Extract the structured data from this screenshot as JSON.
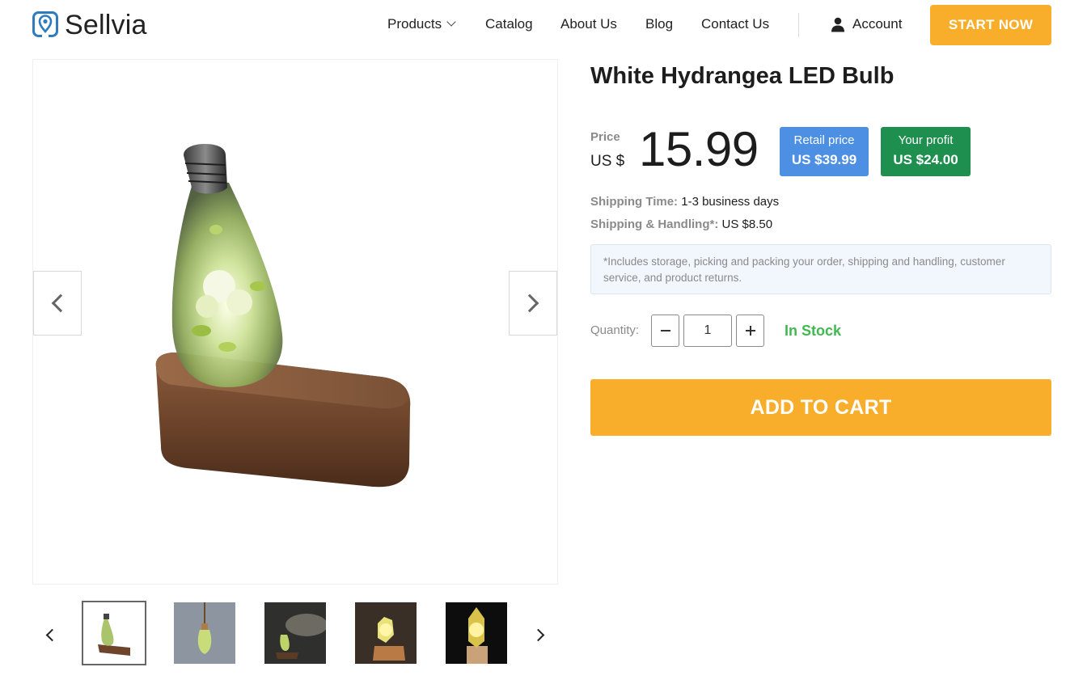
{
  "brand": {
    "name": "Sellvia",
    "logo_icon": "map-pin-logo-icon",
    "accent": "#2e7bc0"
  },
  "nav": {
    "items": [
      {
        "label": "Products",
        "has_dropdown": true
      },
      {
        "label": "Catalog"
      },
      {
        "label": "About Us"
      },
      {
        "label": "Blog"
      },
      {
        "label": "Contact Us"
      }
    ],
    "account_label": "Account",
    "account_icon": "user-icon",
    "cta_label": "START NOW"
  },
  "gallery": {
    "prev_icon": "chevron-left-icon",
    "next_icon": "chevron-right-icon",
    "thumbnail_count": 5,
    "active_thumbnail": 1
  },
  "product": {
    "title": "White Hydrangea LED Bulb",
    "price_label": "Price",
    "currency": "US $",
    "price": "15.99",
    "retail_label": "Retail price",
    "retail_value": "US $39.99",
    "profit_label": "Your profit",
    "profit_value": "US $24.00",
    "shipping_time_label": "Shipping Time:",
    "shipping_time_value": "1-3 business days",
    "shipping_handling_label": "Shipping & Handling*:",
    "shipping_handling_value": "US $8.50",
    "note": "*Includes storage, picking and packing your order, shipping and handling, customer service, and product returns.",
    "quantity_label": "Quantity:",
    "quantity": "1",
    "stock_status": "In Stock",
    "add_to_cart_label": "ADD TO CART"
  },
  "colors": {
    "cta": "#f9ae2b",
    "retail_badge": "#4c8fe3",
    "profit_badge": "#1f8f50",
    "in_stock": "#3fb950"
  }
}
